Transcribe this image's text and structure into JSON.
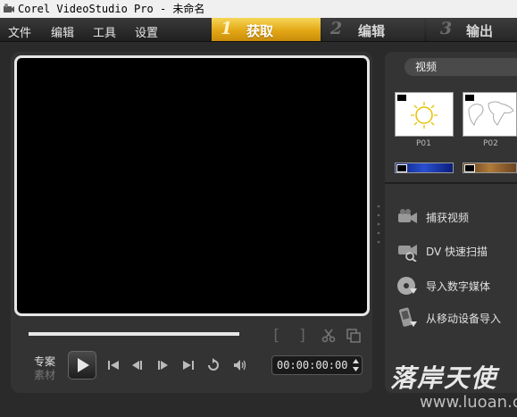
{
  "window": {
    "title": "Corel VideoStudio Pro - 未命名"
  },
  "menu": {
    "items": [
      "文件",
      "编辑",
      "工具",
      "设置"
    ]
  },
  "steps": [
    {
      "num": "1",
      "label": "获取",
      "active": true
    },
    {
      "num": "2",
      "label": "编辑",
      "active": false
    },
    {
      "num": "3",
      "label": "输出",
      "active": false
    }
  ],
  "player": {
    "mode_project": "专案",
    "mode_clip": "素材",
    "timecode": "00:00:00:00",
    "scrub_progress": 1.0,
    "mark_in": "[",
    "mark_out": "]"
  },
  "library": {
    "category": "视频",
    "thumbnails": [
      {
        "caption": "P01",
        "icon": "sun-drawing"
      },
      {
        "caption": "P02",
        "icon": "world-map"
      },
      {
        "caption": "",
        "icon": "blue-clip"
      },
      {
        "caption": "",
        "icon": "brown-clip"
      }
    ]
  },
  "capture_options": [
    {
      "label": "捕获视频",
      "icon": "video-camera-icon"
    },
    {
      "label": "DV 快速扫描",
      "icon": "dv-scan-icon"
    },
    {
      "label": "导入数字媒体",
      "icon": "disc-import-icon"
    },
    {
      "label": "从移动设备导入",
      "icon": "mobile-import-icon"
    }
  ],
  "watermark": {
    "text": "落岸天使",
    "url": "www.luoan.cn"
  },
  "colors": {
    "active_step": "#e3a715",
    "background": "#2b2b2b",
    "panel": "#333333"
  }
}
